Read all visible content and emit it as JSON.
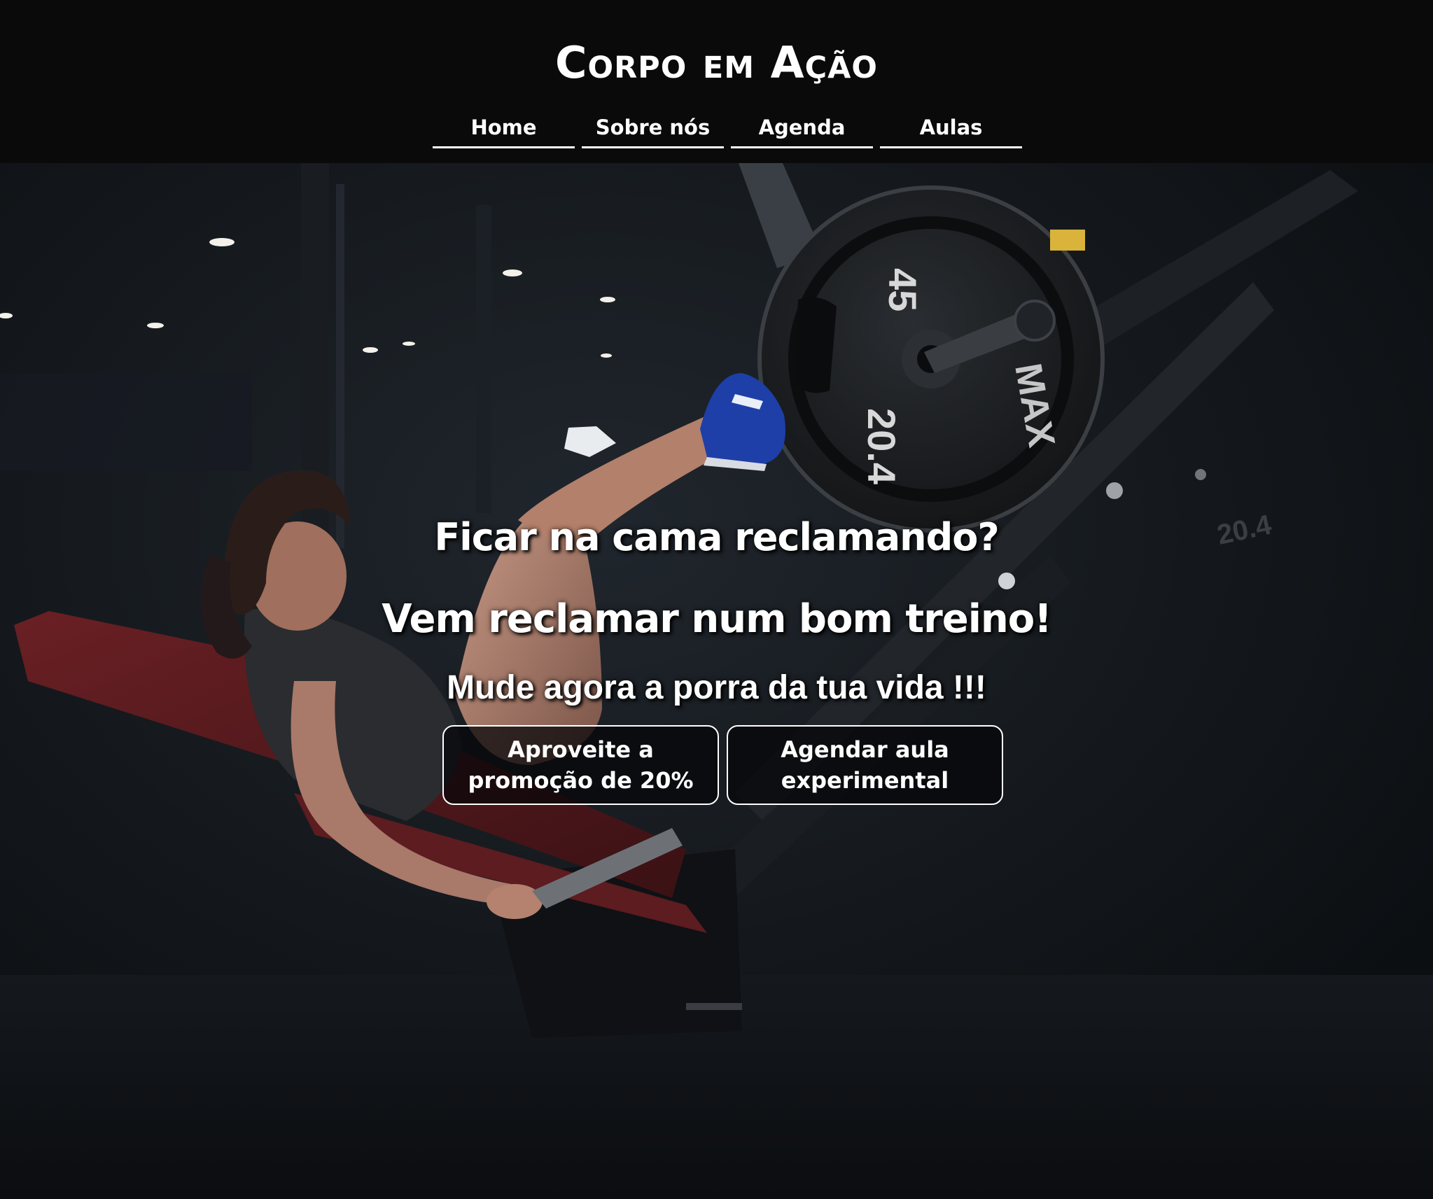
{
  "header": {
    "brand": "Corpo em Ação",
    "nav": [
      {
        "label": "Home"
      },
      {
        "label": "Sobre nós"
      },
      {
        "label": "Agenda"
      },
      {
        "label": "Aulas"
      }
    ]
  },
  "hero": {
    "image_alt": "Woman training on a leg press machine in a dark gym",
    "plate_text_1": "45",
    "plate_text_2": "20.4",
    "plate_brand": "MAX",
    "plate_text_back": "20.4",
    "headline_1": "Ficar na cama reclamando?",
    "headline_2": "Vem reclamar num bom treino!",
    "headline_3": "Mude agora a porra da tua vida !!!",
    "cta_buttons": [
      {
        "label": "Aproveite a promoção de 20%"
      },
      {
        "label": "Agendar aula experimental"
      }
    ]
  },
  "colors": {
    "header_bg": "#0a0a0a",
    "hero_bg": "#13171b",
    "text": "#ffffff",
    "button_border": "#ffffff"
  }
}
